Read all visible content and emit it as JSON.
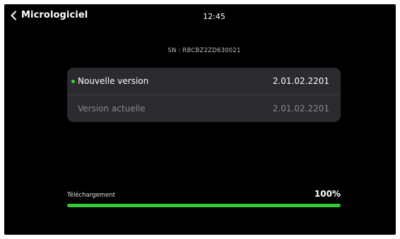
{
  "header": {
    "back_label": "Micrologiciel",
    "time": "12:45"
  },
  "serial": "SN : RBCBZ2ZD630021",
  "versions": {
    "new_label": "Nouvelle version",
    "new_value": "2.01.02.2201",
    "current_label": "Version actuelle",
    "current_value": "2.01.02.2201"
  },
  "download": {
    "label": "Téléchargement",
    "percent_text": "100%",
    "progress": 1.0
  },
  "colors": {
    "background": "#000000",
    "panel": "#2b2b2f",
    "accent_green": "#35c935",
    "status_dot": "#3ecf3e"
  },
  "icons": {
    "back": "chevron-left-icon",
    "status": "status-dot-icon"
  }
}
